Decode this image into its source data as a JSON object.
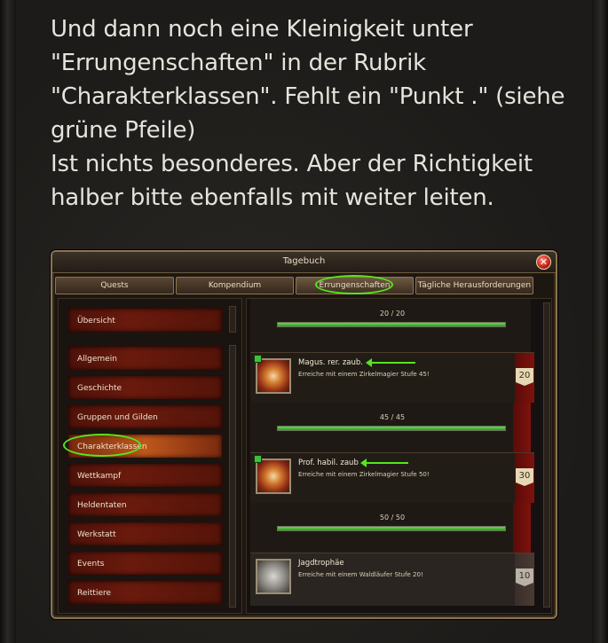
{
  "message": {
    "lines": [
      "Und dann noch eine Kleinigkeit unter",
      "\"Errungenschaften\" in der Rubrik",
      "\"Charakterklassen\". Fehlt ein \"Punkt .\" (siehe",
      "grüne Pfeile)",
      "Ist nichts besonderes. Aber der Richtigkeit",
      "halber bitte ebenfalls mit weiter leiten."
    ]
  },
  "window": {
    "title": "Tagebuch",
    "close_glyph": "✕",
    "tabs": [
      {
        "label": "Quests"
      },
      {
        "label": "Kompendium"
      },
      {
        "label": "Errungenschaften",
        "active": true
      },
      {
        "label": "Tägliche Herausforderungen"
      }
    ]
  },
  "sidebar": {
    "top_item": "Übersicht",
    "items": [
      {
        "label": "Allgemein"
      },
      {
        "label": "Geschichte"
      },
      {
        "label": "Gruppen und Gilden"
      },
      {
        "label": "Charakterklassen",
        "active": true
      },
      {
        "label": "Wettkampf"
      },
      {
        "label": "Heldentaten"
      },
      {
        "label": "Werkstatt"
      },
      {
        "label": "Events"
      },
      {
        "label": "Reittiere"
      }
    ]
  },
  "achievements": {
    "progress_top": {
      "text": "20 / 20",
      "fraction": 1.0
    },
    "list": [
      {
        "title": "Magus. rer. zaub.",
        "description": "Erreiche mit einem Zirkelmagier Stufe 45!",
        "points": "20",
        "progress_text": "45 / 45",
        "progress": 1.0,
        "icon": "magic-circle-icon",
        "completed": true
      },
      {
        "title": "Prof. habil. zaub",
        "description": "Erreiche mit einem Zirkelmagier Stufe 50!",
        "points": "30",
        "progress_text": "50 / 50",
        "progress": 1.0,
        "icon": "magic-circle-icon",
        "completed": true
      },
      {
        "title": "Jagdtrophäe",
        "description": "Erreiche mit einem Waldläufer Stufe 20!",
        "points": "10",
        "icon": "trophy-skull-icon",
        "completed": false
      }
    ]
  },
  "colors": {
    "annotation_green": "#56e61c",
    "nav_red": "#6a1a0d",
    "progress_green": "#4fcf3c",
    "forum_bg": "#1c1b19"
  }
}
